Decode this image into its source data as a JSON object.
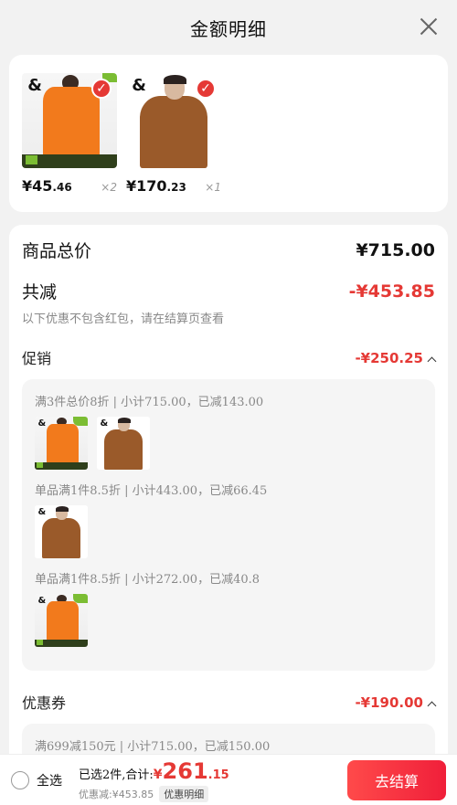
{
  "header": {
    "title": "金额明细"
  },
  "products": [
    {
      "price_int": "¥45",
      "price_dec": ".46",
      "qty": "×2",
      "style": "orange"
    },
    {
      "price_int": "¥170",
      "price_dec": ".23",
      "qty": "×1",
      "style": "brown"
    }
  ],
  "summary": {
    "total_label": "商品总价",
    "total_value": "¥715.00",
    "discount_label": "共减",
    "discount_value": "-¥453.85",
    "note": "以下优惠不包含红包，请在结算页查看"
  },
  "promo": {
    "label": "促销",
    "value": "-¥250.25",
    "groups": [
      {
        "title": "满3件总价8折 | 小计715.00，已减143.00",
        "thumbs": [
          "orange",
          "brown"
        ]
      },
      {
        "title": "单品满1件8.5折 | 小计443.00，已减66.45",
        "thumbs": [
          "brown"
        ]
      },
      {
        "title": "单品满1件8.5折 | 小计272.00，已减40.8",
        "thumbs": [
          "orange"
        ]
      }
    ]
  },
  "coupon": {
    "label": "优惠券",
    "value": "-¥190.00",
    "groups": [
      {
        "title": "满699减150元 | 小计715.00，已减150.00",
        "thumbs": [
          "orange",
          "brown"
        ]
      }
    ]
  },
  "bottom": {
    "select_all": "全选",
    "selected_text": "已选2件,合计:",
    "total_symbol": "¥",
    "total_int": "261",
    "total_dec": ".15",
    "discount_text": "优惠减:¥453.85",
    "detail_label": "优惠明细",
    "pay_label": "去结算"
  },
  "colors": {
    "accent": "#e53935",
    "pay_button": "#f01f3a"
  },
  "icons": {
    "close": "close-icon",
    "check": "check-icon",
    "chevron": "chevron-up-icon"
  }
}
